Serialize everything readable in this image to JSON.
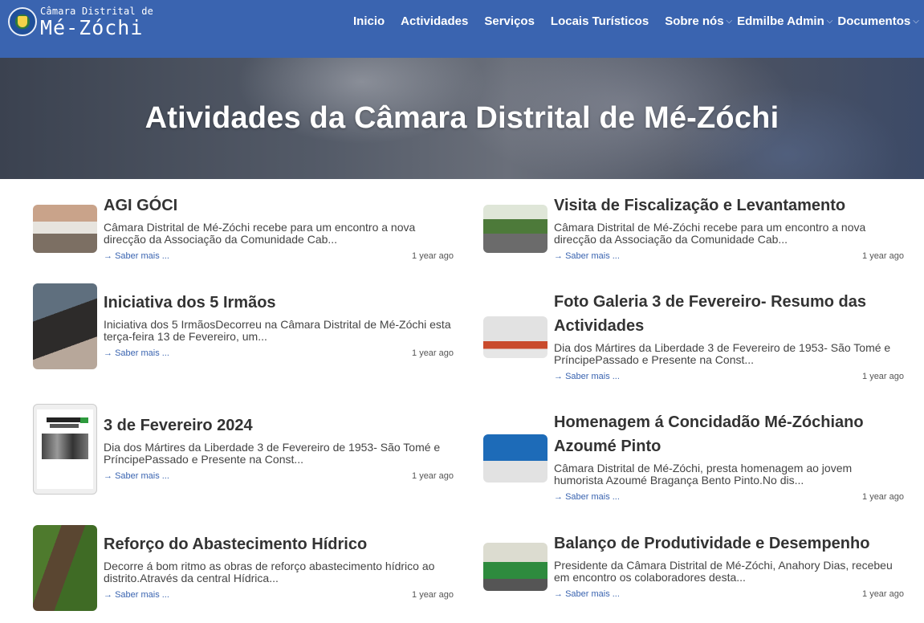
{
  "header": {
    "logo_small": "Câmara Distrital de",
    "logo_big": "Mé-Zóchi",
    "nav": [
      {
        "label": "Inicio",
        "caret": false
      },
      {
        "label": "Actividades",
        "caret": false
      },
      {
        "label": "Serviços",
        "caret": false
      },
      {
        "label": "Locais Turísticos",
        "caret": false
      },
      {
        "label": "Sobre nós",
        "caret": true
      },
      {
        "label": "Edmilbe Admin",
        "caret": true
      },
      {
        "label": "Documentos",
        "caret": true
      }
    ]
  },
  "hero": {
    "title": "Atividades da Câmara Distrital de Mé-Zóchi"
  },
  "articles": [
    {
      "title": "AGI GÓCI",
      "excerpt": "Câmara Distrital de Mé-Zóchi recebe para um encontro a nova direcção da Associação da Comunidade Cab...",
      "more": "Saber mais ...",
      "date": "1 year ago"
    },
    {
      "title": "Visita de Fiscalização e Levantamento",
      "excerpt": "Câmara Distrital de Mé-Zóchi recebe para um encontro a nova direcção da Associação da Comunidade Cab...",
      "more": "Saber mais ...",
      "date": "1 year ago"
    },
    {
      "title": "Iniciativa dos 5 Irmãos",
      "excerpt": "Iniciativa dos 5 IrmãosDecorreu na Câmara Distrital de Mé-Zóchi esta terça-feira 13 de Fevereiro, um...",
      "more": "Saber mais ...",
      "date": "1 year ago"
    },
    {
      "title": "Foto Galeria 3 de Fevereiro- Resumo das Actividades",
      "excerpt": "Dia dos Mártires da Liberdade 3 de Fevereiro de 1953- São Tomé e PríncipePassado e Presente na Const...",
      "more": "Saber mais ...",
      "date": "1 year ago"
    },
    {
      "title": "3 de Fevereiro 2024",
      "excerpt": "Dia dos Mártires da Liberdade 3 de Fevereiro de 1953- São Tomé e PríncipePassado e Presente na Const...",
      "more": "Saber mais ...",
      "date": "1 year ago"
    },
    {
      "title": "Homenagem á Concidadão Mé-Zóchiano Azoumé Pinto",
      "excerpt": "Câmara Distrital de Mé-Zóchi, presta homenagem ao jovem humorista Azoumé Bragança Bento Pinto.No dis...",
      "more": "Saber mais ...",
      "date": "1 year ago"
    },
    {
      "title": "Reforço do Abastecimento Hídrico",
      "excerpt": "Decorre á bom ritmo as obras de reforço abastecimento hídrico ao distrito.Através da central Hídrica...",
      "more": "Saber mais ...",
      "date": "1 year ago"
    },
    {
      "title": "Balanço de Produtividade e Desempenho",
      "excerpt": "Presidente da Câmara Distrital de Mé-Zóchi, Anahory Dias, recebeu em encontro os colaboradores desta...",
      "more": "Saber mais ...",
      "date": "1 year ago"
    }
  ]
}
